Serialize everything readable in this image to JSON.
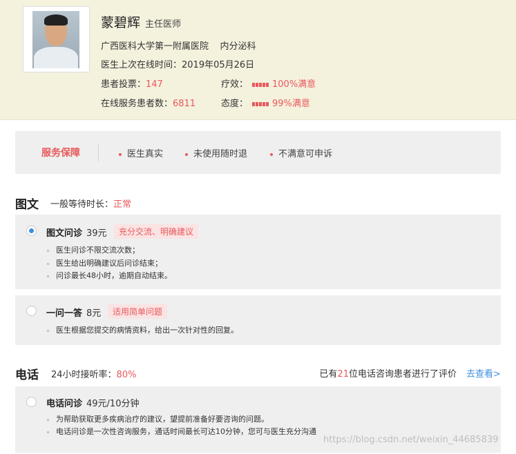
{
  "doctor": {
    "name": "蒙碧辉",
    "title": "主任医师",
    "hospital": "广西医科大学第一附属医院",
    "department": "内分泌科",
    "last_online_label": "医生上次在线时间：",
    "last_online": "2019年05月26日",
    "votes_label": "患者投票：",
    "votes": "147",
    "served_label": "在线服务患者数：",
    "served": "6811",
    "efficacy_label": "疗效：",
    "efficacy": "100%满意",
    "attitude_label": "态度：",
    "attitude": "99%满意"
  },
  "guarantee": {
    "title": "服务保障",
    "items": [
      "医生真实",
      "未使用随时退",
      "不满意可申诉"
    ]
  },
  "text_section": {
    "title": "图文",
    "wait_label": "一般等待时长：",
    "wait_value": "正常"
  },
  "services": [
    {
      "name": "图文问诊",
      "price": "39元",
      "tag": "充分交流、明确建议",
      "selected": true,
      "bullets": [
        "医生问诊不限交流次数；",
        "医生给出明确建议后问诊结束；",
        "问诊最长48小时，逾期自动结束。"
      ]
    },
    {
      "name": "一问一答",
      "price": "8元",
      "tag": "适用简单问题",
      "selected": false,
      "bullets": [
        "医生根据您提交的病情资料，给出一次针对性的回复。"
      ]
    }
  ],
  "phone_section": {
    "title": "电话",
    "rate_label": "24小时接听率：",
    "rate_value": "80%",
    "review_prefix": "已有",
    "review_count": "21",
    "review_suffix": "位电话咨询患者进行了评价",
    "review_link": "去查看>"
  },
  "phone_service": {
    "name": "电话问诊",
    "price": "49元/10分钟",
    "bullets": [
      "为帮助获取更多疾病治疗的建议，望提前准备好要咨询的问题。",
      "电话问诊是一次性咨询服务，通话时间最长可达10分钟，您可与医生充分沟通"
    ]
  },
  "watermark": "https://blog.csdn.net/weixin_44685839",
  "colors": {
    "accent_red": "#e8595c",
    "link_blue": "#3d8fde",
    "header_bg": "#f4f1dd",
    "card_bg": "#efefef"
  }
}
